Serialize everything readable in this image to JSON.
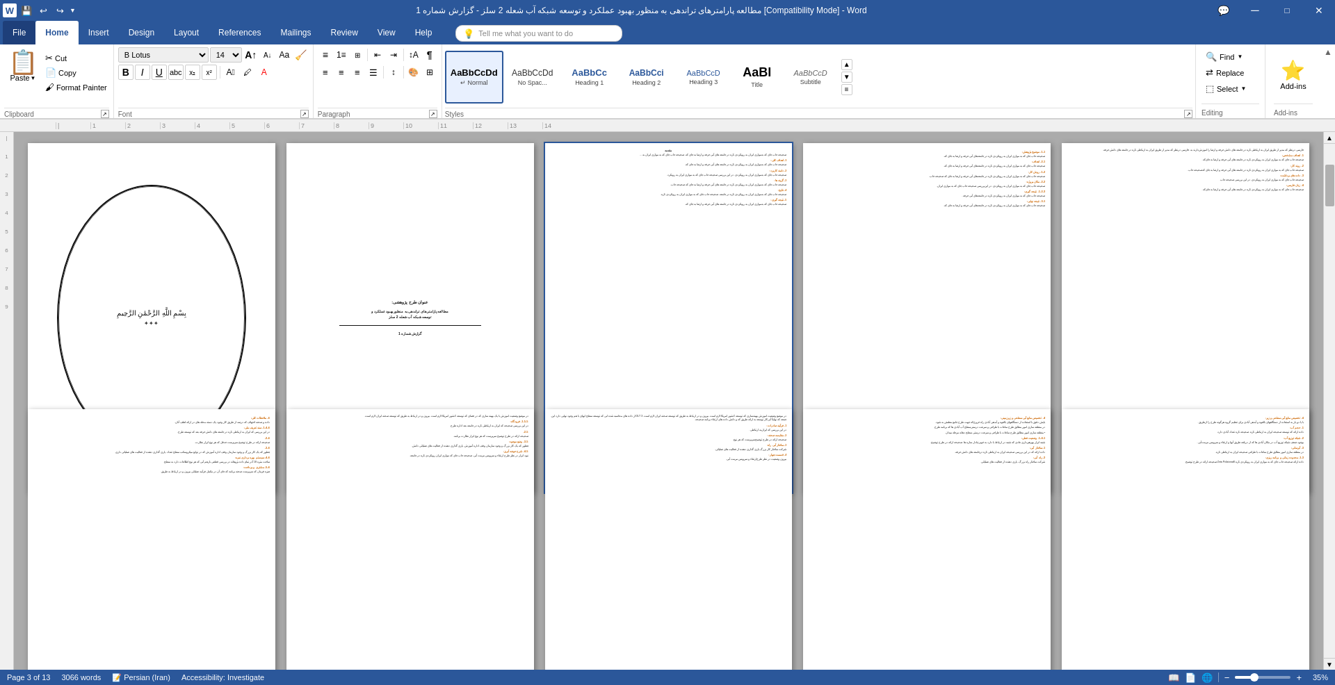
{
  "app": {
    "title": "مطالعه پارامترهای تراندهی به منظور بهبود عملکرد و توسعه شبکه آب شعله 2 سلز - گزارش شماره 1 [Compatibility Mode] - Word",
    "quickAccess": [
      "💾",
      "↩",
      "↪",
      "▼"
    ]
  },
  "tabs": [
    {
      "label": "File",
      "active": false
    },
    {
      "label": "Home",
      "active": true
    },
    {
      "label": "Insert",
      "active": false
    },
    {
      "label": "Design",
      "active": false
    },
    {
      "label": "Layout",
      "active": false
    },
    {
      "label": "References",
      "active": false
    },
    {
      "label": "Mailings",
      "active": false
    },
    {
      "label": "Review",
      "active": false
    },
    {
      "label": "View",
      "active": false
    },
    {
      "label": "Help",
      "active": false
    }
  ],
  "ribbon": {
    "clipboard": {
      "label": "Clipboard",
      "paste_label": "Paste",
      "cut_label": "Cut",
      "copy_label": "Copy",
      "format_painter_label": "Format Painter"
    },
    "font": {
      "label": "Font",
      "font_name": "B Lotus",
      "font_size": "14",
      "bold": "B",
      "italic": "I",
      "underline": "U",
      "strikethrough": "abc",
      "subscript": "x₂",
      "superscript": "x²"
    },
    "paragraph": {
      "label": "Paragraph"
    },
    "styles": {
      "label": "Styles",
      "items": [
        {
          "label": "Normal",
          "preview": "AaBbCcDd",
          "active": true
        },
        {
          "label": "No Spac...",
          "preview": "AaBbCcDd",
          "active": false
        },
        {
          "label": "Heading 1",
          "preview": "AaBbCc",
          "active": false
        },
        {
          "label": "Heading 2",
          "preview": "AaBbCci",
          "active": false
        },
        {
          "label": "Heading 3",
          "preview": "AaBbCcD",
          "active": false
        },
        {
          "label": "Title",
          "preview": "AaBl",
          "active": false
        },
        {
          "label": "Subtitle",
          "preview": "AaBbCcD",
          "active": false
        }
      ]
    },
    "editing": {
      "label": "Editing",
      "find_label": "Find",
      "replace_label": "Replace",
      "select_label": "Select"
    },
    "addins": {
      "label": "Add-ins",
      "label_text": "Add-ins"
    }
  },
  "tell_me": {
    "placeholder": "Tell me what you want to do"
  },
  "status_bar": {
    "page": "Page 3 of 13",
    "words": "3066 words",
    "language": "Persian (Iran)",
    "accessibility": "Accessibility: Investigate",
    "zoom": "35%"
  },
  "pages": [
    {
      "id": 1,
      "type": "image",
      "description": "Calligraphy page with bismillah"
    },
    {
      "id": 2,
      "type": "title",
      "title": "عنوان طرح پژوهشی:",
      "subtitle": "مطالعه پارامترهای تراندهی به منظور بهبود عملکرد و توسعه شبکه آب شعله 2 سلز",
      "report": "گزارش شماره 1"
    },
    {
      "id": 3,
      "type": "content",
      "description": "Main text with orange section headers"
    },
    {
      "id": 4,
      "type": "content",
      "description": "Content page with orange headers"
    },
    {
      "id": 5,
      "type": "content",
      "description": "Content page"
    },
    {
      "id": 6,
      "type": "content",
      "description": "Bottom row page 1"
    },
    {
      "id": 7,
      "type": "content",
      "description": "Bottom row page 2"
    },
    {
      "id": 8,
      "type": "content",
      "description": "Bottom row page 3"
    },
    {
      "id": 9,
      "type": "content",
      "description": "Bottom row page 4"
    },
    {
      "id": 10,
      "type": "content",
      "description": "Bottom row page 5"
    }
  ]
}
